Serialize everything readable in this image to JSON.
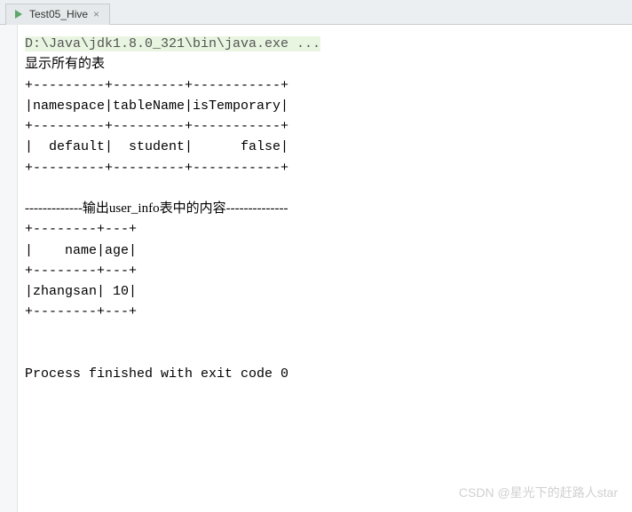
{
  "tab": {
    "title": "Test05_Hive",
    "close_label": "×"
  },
  "console": {
    "command": "D:\\Java\\jdk1.8.0_321\\bin\\java.exe ...",
    "heading1": "显示所有的表",
    "table1": {
      "border_top": "+---------+---------+-----------+",
      "header": "|namespace|tableName|isTemporary|",
      "border_mid": "+---------+---------+-----------+",
      "row1": "|  default|  student|      false|",
      "border_bottom": "+---------+---------+-----------+"
    },
    "heading2": "-------------输出user_info表中的内容--------------",
    "table2": {
      "border_top": "+--------+---+",
      "header": "|    name|age|",
      "border_mid": "+--------+---+",
      "row1": "|zhangsan| 10|",
      "border_bottom": "+--------+---+"
    },
    "exit_message": "Process finished with exit code 0"
  },
  "watermark": "CSDN @星光下的赶路人star"
}
